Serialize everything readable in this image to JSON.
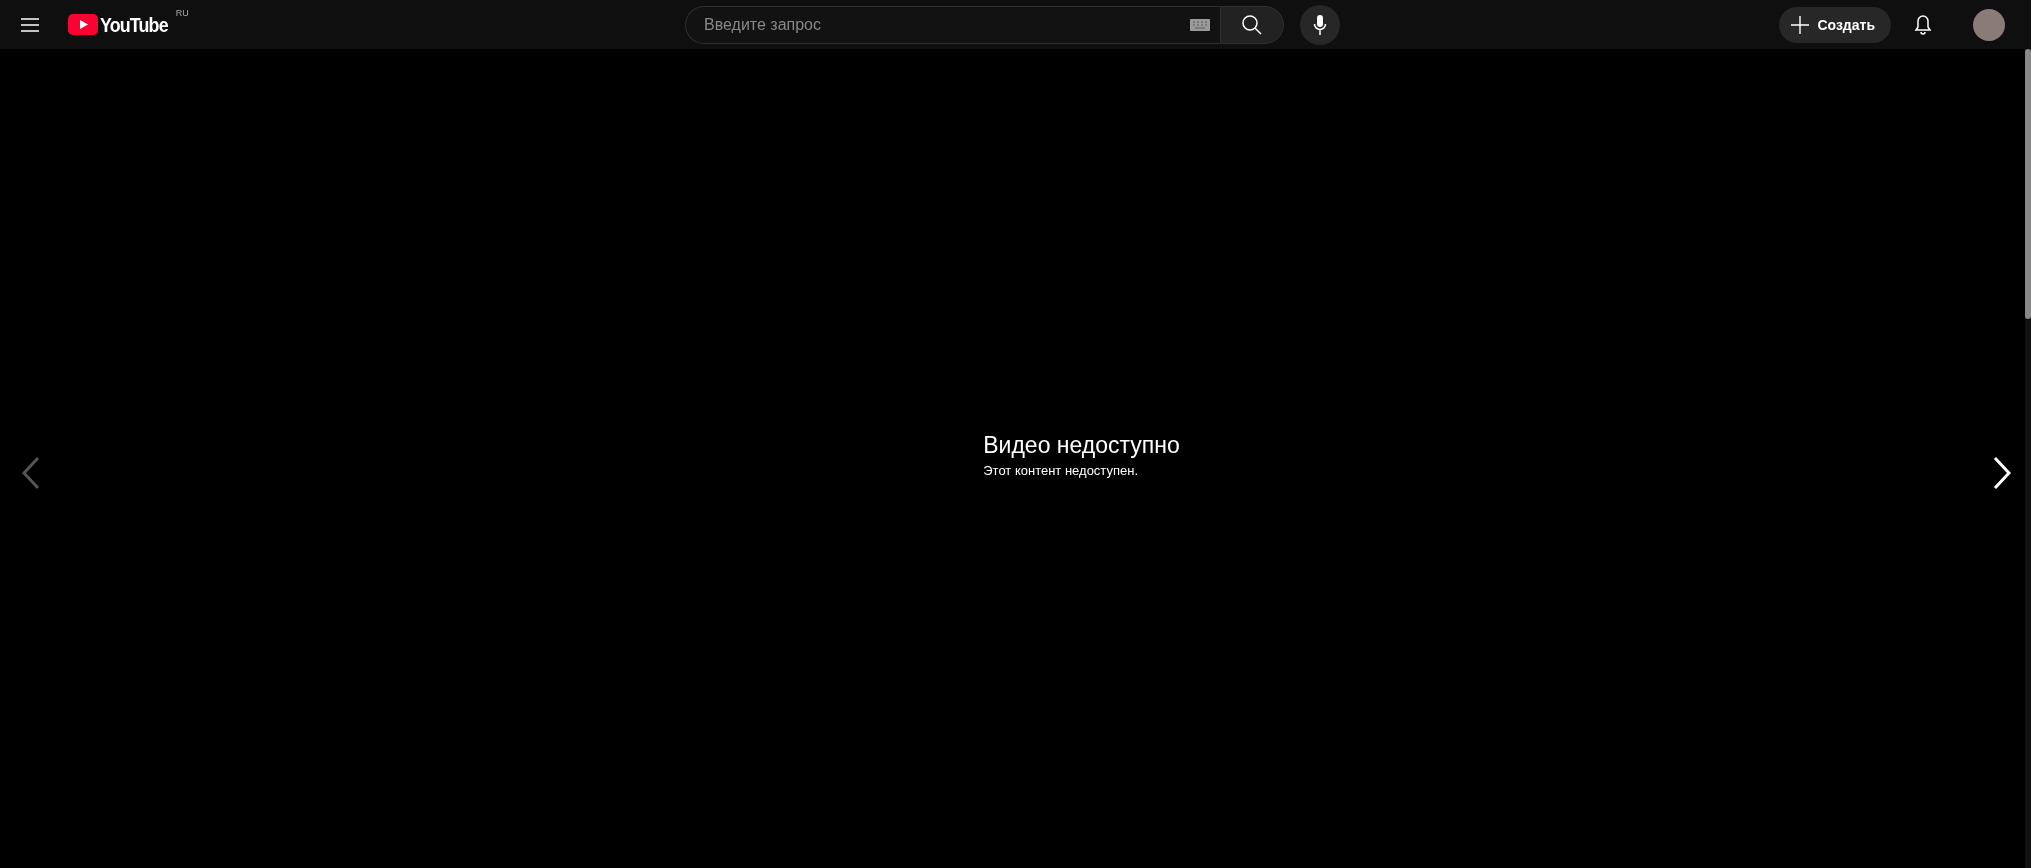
{
  "header": {
    "logo_text": "YouTube",
    "region": "RU",
    "search": {
      "placeholder": "Введите запрос"
    },
    "create_button": "Создать"
  },
  "player": {
    "title": "Видео недоступно",
    "message": "Этот контент недоступен.",
    "previous": {
      "disabled": true
    },
    "next": {
      "disabled": false
    }
  }
}
